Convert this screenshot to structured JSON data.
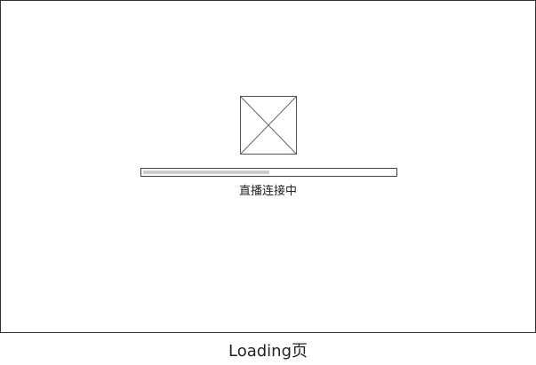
{
  "screen": {
    "status_text": "直播连接中",
    "progress_fraction": 0.5
  },
  "caption": "Loading页",
  "colors": {
    "border": "#333333",
    "progress_fill": "#cccccc",
    "text": "#222222"
  },
  "icons": {
    "placeholder": "image-placeholder-icon"
  }
}
